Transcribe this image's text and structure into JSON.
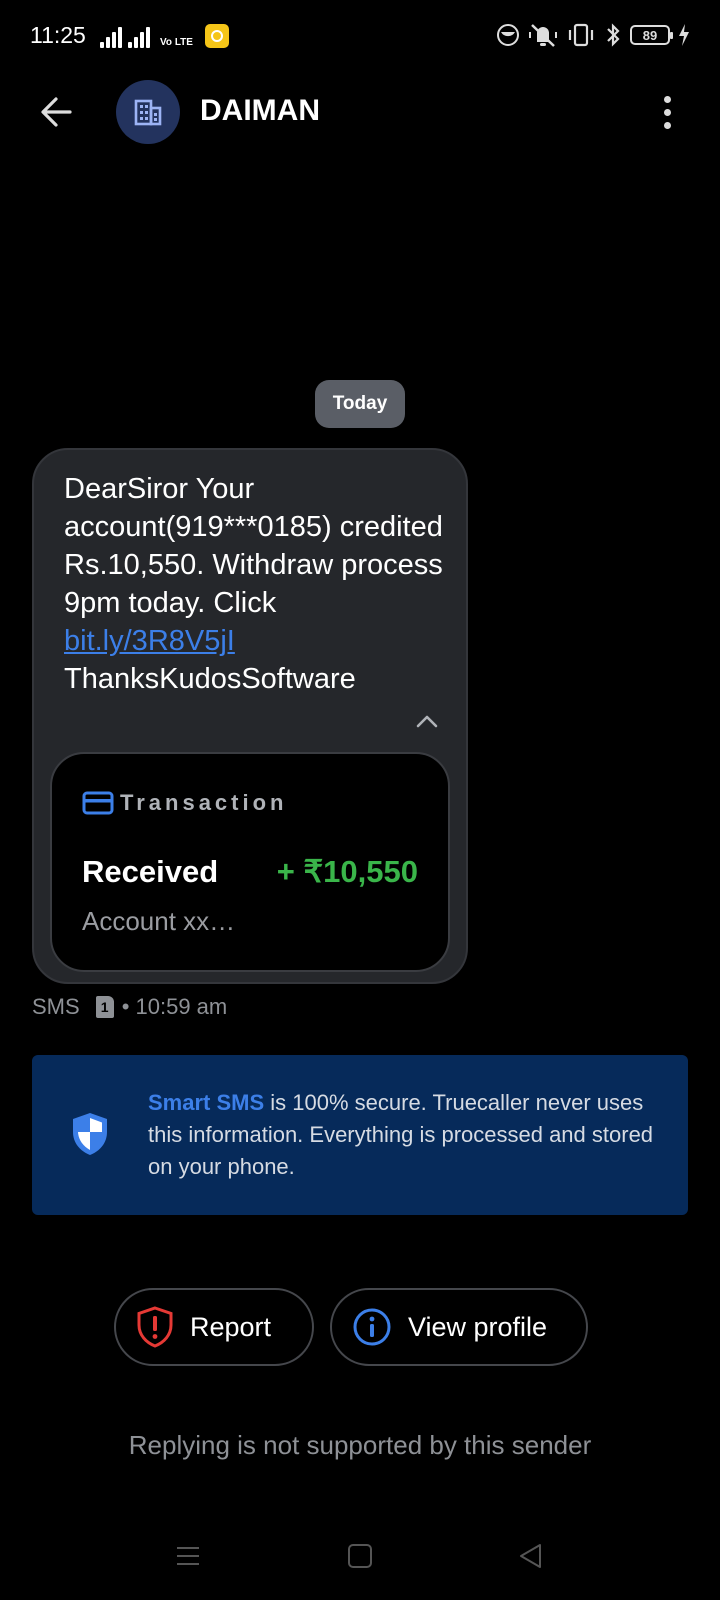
{
  "status_bar": {
    "time": "11:25",
    "volte_label": "Vo LTE",
    "battery_level": "89"
  },
  "header": {
    "contact_name": "DAIMAN"
  },
  "chat": {
    "date_chip": "Today",
    "message": {
      "text_before_link": "DearSiror Your account(919***0185) credited Rs.10,550. Withdraw process  9pm today. Click ",
      "link_text": "bit.ly/3R8V5jI",
      "text_after_link": "ThanksKudosSoftware",
      "transaction": {
        "label": "Transaction",
        "status": "Received",
        "amount": "+ ₹10,550",
        "account": "Account xx…"
      },
      "meta_channel": "SMS",
      "meta_sim": "1",
      "meta_time": "• 10:59 am"
    }
  },
  "info_banner": {
    "highlight": "Smart SMS",
    "text": " is 100% secure. Truecaller never uses this information. Everything is processed and stored on your phone."
  },
  "actions": {
    "report_label": "Report",
    "view_profile_label": "View profile"
  },
  "footer": {
    "reply_note": "Replying is not supported by this sender"
  },
  "colors": {
    "link": "#3c7fe8",
    "amount_positive": "#3ab54a",
    "report_red": "#e53935",
    "banner_bg": "#062a5a"
  }
}
